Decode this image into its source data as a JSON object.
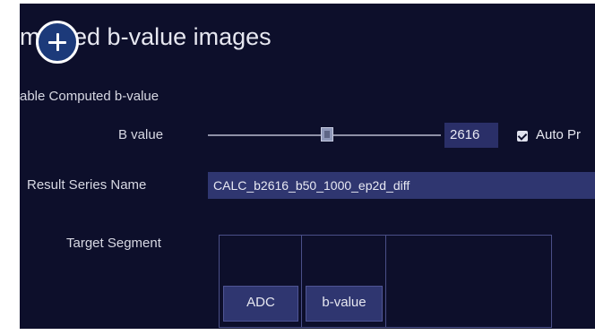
{
  "panel": {
    "title": "mputed b-value images",
    "enable_label": "able Computed b-value"
  },
  "bvalue": {
    "label": "B value",
    "value": "2616",
    "slider_fraction": 0.5,
    "auto_label": "Auto Pr",
    "auto_checked": true
  },
  "result": {
    "label": "Result Series Name",
    "value": "CALC_b2616_b50_1000_ep2d_diff"
  },
  "segment": {
    "label": "Target Segment",
    "buttons": [
      "ADC",
      "b-value"
    ]
  },
  "overlay": {
    "icon": "plus-icon"
  },
  "colors": {
    "background": "#0d0f2b",
    "field": "#2f3670",
    "overlay_button": "#1c3a7a"
  }
}
